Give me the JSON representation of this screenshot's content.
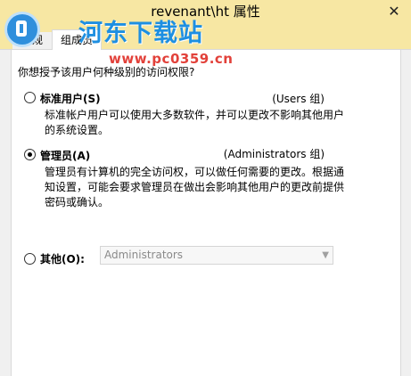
{
  "window": {
    "title": "revenant\\ht 属性",
    "close_glyph": "✕"
  },
  "tabs": [
    {
      "label": "常规"
    },
    {
      "label": "组成员"
    }
  ],
  "watermark": {
    "title": "河东下载站",
    "url": "www.pc0359.cn"
  },
  "question": "你想授予该用户何种级别的访问权限?",
  "options": {
    "standard": {
      "label": "标准用户(S)",
      "group": "(Users 组)",
      "description": "标准帐户用户可以使用大多数软件，并可以更改不影响其他用户的系统设置。",
      "checked": false
    },
    "admin": {
      "label": "管理员(A)",
      "group": "(Administrators 组)",
      "description": "管理员有计算机的完全访问权，可以做任何需要的更改。根据通知设置，可能会要求管理员在做出会影响其他用户的更改前提供密码或确认。",
      "checked": true
    },
    "other": {
      "label": "其他(O):",
      "select_value": "Administrators",
      "checked": false
    }
  }
}
